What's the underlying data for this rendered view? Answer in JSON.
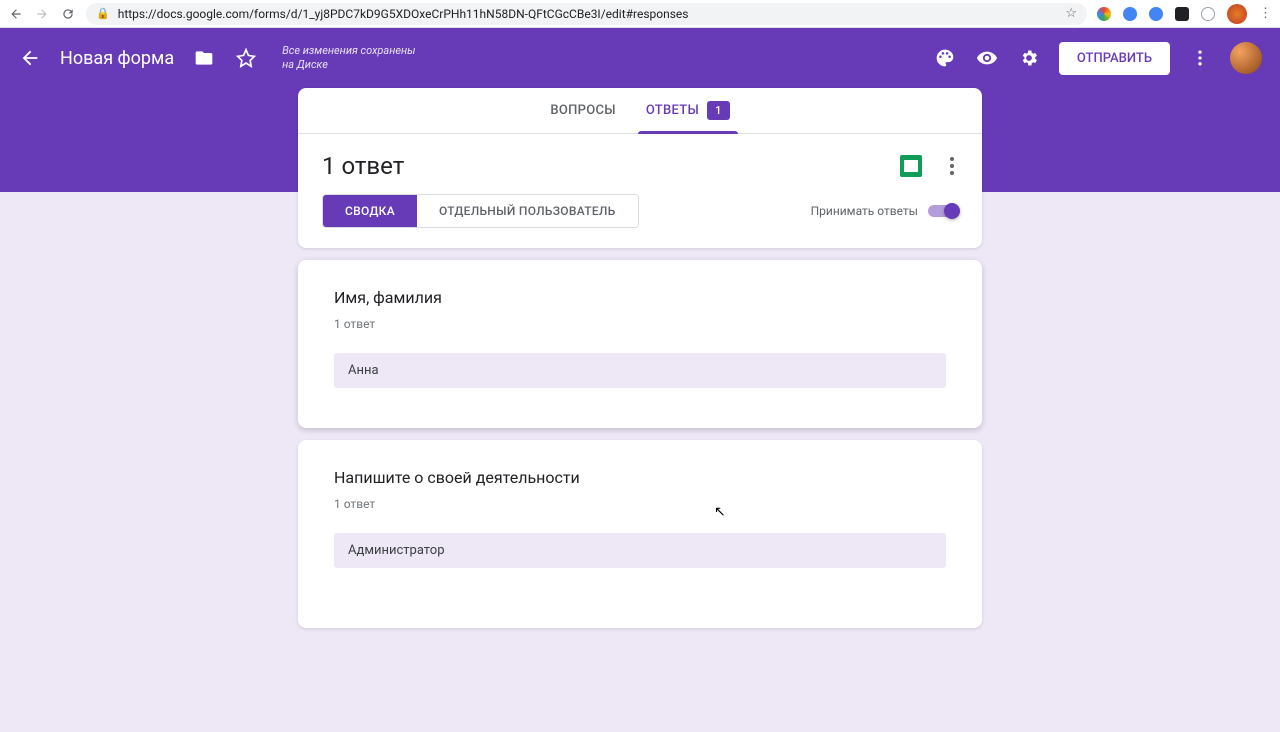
{
  "browser": {
    "url": "https://docs.google.com/forms/d/1_yj8PDC7kD9G5XDOxeCrPHh11hN58DN-QFtCGcCBe3I/edit#responses"
  },
  "header": {
    "form_title": "Новая форма",
    "saved_line1": "Все изменения сохранены",
    "saved_line2": "на Диске",
    "send_button": "ОТПРАВИТЬ"
  },
  "tabs": {
    "questions": "ВОПРОСЫ",
    "responses": "ОТВЕТЫ",
    "badge": "1"
  },
  "responses": {
    "count_title": "1 ответ",
    "seg_summary": "СВОДКА",
    "seg_individual": "ОТДЕЛЬНЫЙ ПОЛЬЗОВАТЕЛЬ",
    "accept_label": "Принимать ответы"
  },
  "questions": [
    {
      "title": "Имя, фамилия",
      "count": "1 ответ",
      "answer": "Анна"
    },
    {
      "title": "Напишите о своей деятельности",
      "count": "1 ответ",
      "answer": "Администратор"
    }
  ]
}
